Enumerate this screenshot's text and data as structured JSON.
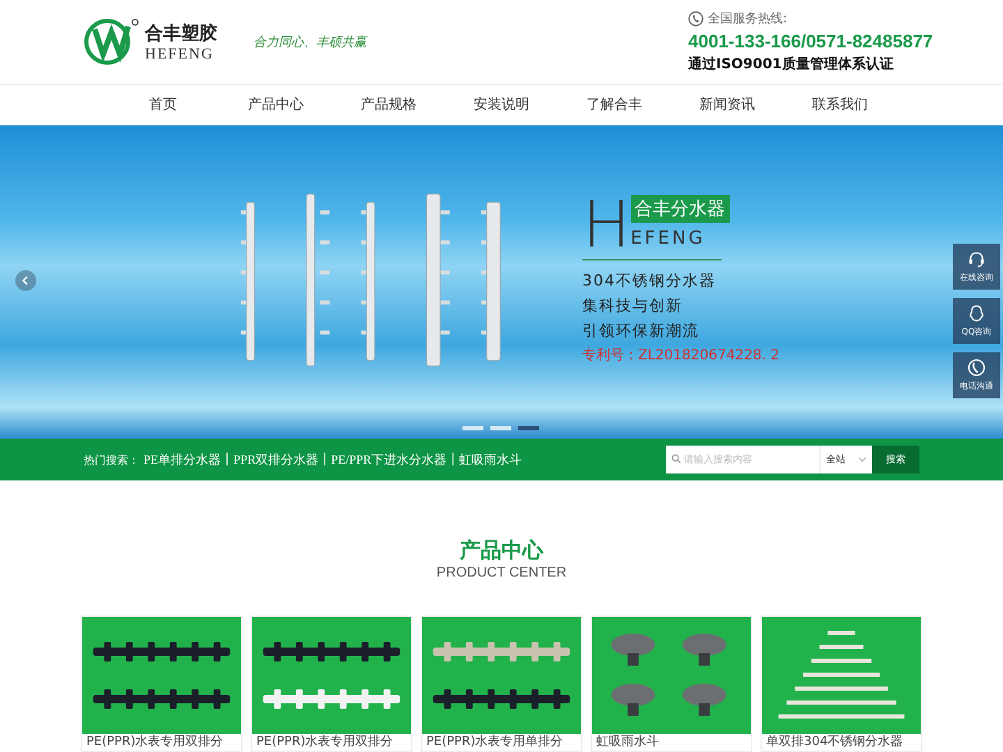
{
  "header": {
    "logo_name": "合丰塑胶",
    "logo_latin": "HEFENG",
    "slogan": "合力同心、丰硕共赢",
    "hotline_label": "全国服务热线:",
    "hotline": "4001-133-166/0571-82485877",
    "certification": "通过ISO9001质量管理体系认证"
  },
  "nav": [
    {
      "label": "首页"
    },
    {
      "label": "产品中心"
    },
    {
      "label": "产品规格"
    },
    {
      "label": "安装说明"
    },
    {
      "label": "了解合丰"
    },
    {
      "label": "新闻资讯"
    },
    {
      "label": "联系我们"
    }
  ],
  "banner": {
    "big_letter": "H",
    "badge": "合丰分水器",
    "latin": "EFENG",
    "lines": [
      "304不锈钢分水器",
      "集科技与创新",
      "引领环保新潮流"
    ],
    "patent": "专利号：ZL201820674228. 2",
    "dots": [
      {
        "selected": false
      },
      {
        "selected": false
      },
      {
        "selected": true
      }
    ]
  },
  "side_buttons": [
    {
      "kind": "headset",
      "label": "在线咨询"
    },
    {
      "kind": "qq",
      "label": "QQ咨询"
    },
    {
      "kind": "phone",
      "label": "电话沟通"
    }
  ],
  "search_bar": {
    "hot_label": "热门搜索：",
    "hot_links": [
      {
        "kind": "link",
        "text": "PE单排分水器"
      },
      {
        "kind": "separator",
        "text": "|"
      },
      {
        "kind": "link",
        "text": "PPR双排分水器"
      },
      {
        "kind": "separator",
        "text": "|"
      },
      {
        "kind": "link",
        "text": "PE/PPR下进水分水器"
      },
      {
        "kind": "separator",
        "text": "|"
      },
      {
        "kind": "link",
        "text": "虹吸雨水斗"
      }
    ],
    "placeholder": "请输入搜索内容",
    "scope": "全站",
    "button": "搜索"
  },
  "section": {
    "title": "产品中心",
    "subtitle": "PRODUCT CENTER"
  },
  "products": [
    {
      "kind": "black-double",
      "caption": "PE(PPR)水表专用双排分"
    },
    {
      "kind": "black-white",
      "caption": "PE(PPR)水表专用双排分"
    },
    {
      "kind": "mixed-single",
      "caption": "PE(PPR)水表专用单排分"
    },
    {
      "kind": "siphon",
      "caption": "虹吸雨水斗"
    },
    {
      "kind": "steel",
      "caption": "单双排304不锈钢分水器"
    }
  ]
}
